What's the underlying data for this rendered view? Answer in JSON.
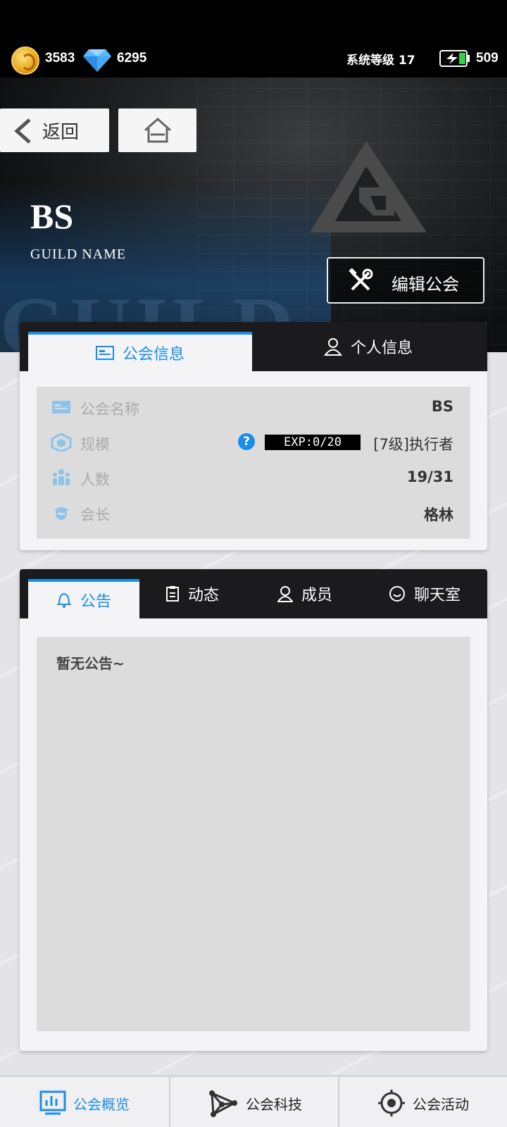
{
  "status": {
    "coins": "3583",
    "diamonds": "6295",
    "system_level": "系统等级 17",
    "energy": "509"
  },
  "nav": {
    "back_label": "返回"
  },
  "guild": {
    "name": "BS",
    "subtitle": "GUILD NAME",
    "edit_label": "编辑公会"
  },
  "info_panel": {
    "tabs": [
      {
        "label": "公会信息",
        "active": true
      },
      {
        "label": "个人信息",
        "active": false
      }
    ],
    "rows": [
      {
        "key": "公会名称",
        "value": "BS"
      },
      {
        "key": "规模",
        "exp": "EXP:0/20",
        "value": "[7级]执行者"
      },
      {
        "key": "人数",
        "value": "19/31"
      },
      {
        "key": "会长",
        "value": "格林"
      }
    ]
  },
  "notice_panel": {
    "tabs": [
      {
        "label": "公告",
        "active": true
      },
      {
        "label": "动态",
        "active": false
      },
      {
        "label": "成员",
        "active": false
      },
      {
        "label": "聊天室",
        "active": false
      }
    ],
    "content": "暂无公告~"
  },
  "bottom_nav": [
    {
      "label": "公会概览",
      "active": true
    },
    {
      "label": "公会科技",
      "active": false
    },
    {
      "label": "公会活动",
      "active": false
    }
  ],
  "colors": {
    "accent": "#1a8ee6",
    "dark": "#1b1b1d",
    "panel": "#f4f4f6"
  }
}
